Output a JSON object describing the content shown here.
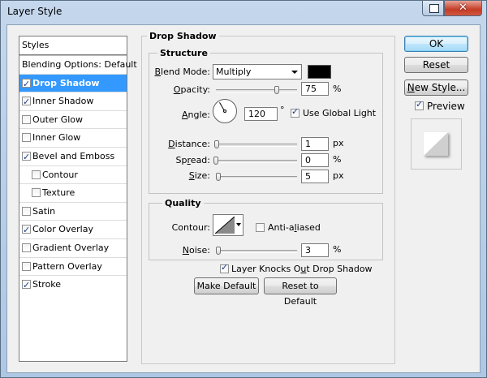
{
  "window": {
    "title": "Layer Style",
    "close_glyph": "✕"
  },
  "styles_list": {
    "header": "Styles",
    "items": [
      {
        "label": "Blending Options: Default",
        "checkbox": false,
        "checked": false,
        "indent": false,
        "selected": false
      },
      {
        "label": "Drop Shadow",
        "checkbox": true,
        "checked": true,
        "indent": false,
        "selected": true
      },
      {
        "label": "Inner Shadow",
        "checkbox": true,
        "checked": true,
        "indent": false,
        "selected": false
      },
      {
        "label": "Outer Glow",
        "checkbox": true,
        "checked": false,
        "indent": false,
        "selected": false
      },
      {
        "label": "Inner Glow",
        "checkbox": true,
        "checked": false,
        "indent": false,
        "selected": false
      },
      {
        "label": "Bevel and Emboss",
        "checkbox": true,
        "checked": true,
        "indent": false,
        "selected": false
      },
      {
        "label": "Contour",
        "checkbox": true,
        "checked": false,
        "indent": true,
        "selected": false
      },
      {
        "label": "Texture",
        "checkbox": true,
        "checked": false,
        "indent": true,
        "selected": false
      },
      {
        "label": "Satin",
        "checkbox": true,
        "checked": false,
        "indent": false,
        "selected": false
      },
      {
        "label": "Color Overlay",
        "checkbox": true,
        "checked": true,
        "indent": false,
        "selected": false
      },
      {
        "label": "Gradient Overlay",
        "checkbox": true,
        "checked": false,
        "indent": false,
        "selected": false
      },
      {
        "label": "Pattern Overlay",
        "checkbox": true,
        "checked": false,
        "indent": false,
        "selected": false
      },
      {
        "label": "Stroke",
        "checkbox": true,
        "checked": true,
        "indent": false,
        "selected": false
      }
    ]
  },
  "drop_shadow": {
    "section_title": "Drop Shadow",
    "structure": {
      "title": "Structure",
      "blend_mode_label": "Blend Mode:",
      "blend_mode_value": "Multiply",
      "shadow_color": "#000000",
      "opacity_label": "Opacity:",
      "opacity_value": "75",
      "opacity_fraction": 0.75,
      "angle_label": "Angle:",
      "angle_value": "120",
      "angle_unit": "°",
      "use_global_light_label": "Use Global Light",
      "use_global_light_checked": true,
      "distance_label": "Distance:",
      "distance_value": "1",
      "distance_unit": "px",
      "spread_label": "Spread:",
      "spread_value": "0",
      "size_label": "Size:",
      "size_value": "5",
      "percent_unit": "%",
      "px_unit": "px"
    },
    "quality": {
      "title": "Quality",
      "contour_label": "Contour:",
      "anti_aliased_label": "Anti-aliased",
      "anti_aliased_checked": false,
      "noise_label": "Noise:",
      "noise_value": "3",
      "noise_unit": "%"
    },
    "knockout_label": "Layer Knocks Out Drop Shadow",
    "knockout_checked": true,
    "make_default_label": "Make Default",
    "reset_default_label": "Reset to Default"
  },
  "actions": {
    "ok_label": "OK",
    "reset_label": "Reset",
    "new_style_label": "New Style...",
    "preview_label": "Preview",
    "preview_checked": true
  }
}
